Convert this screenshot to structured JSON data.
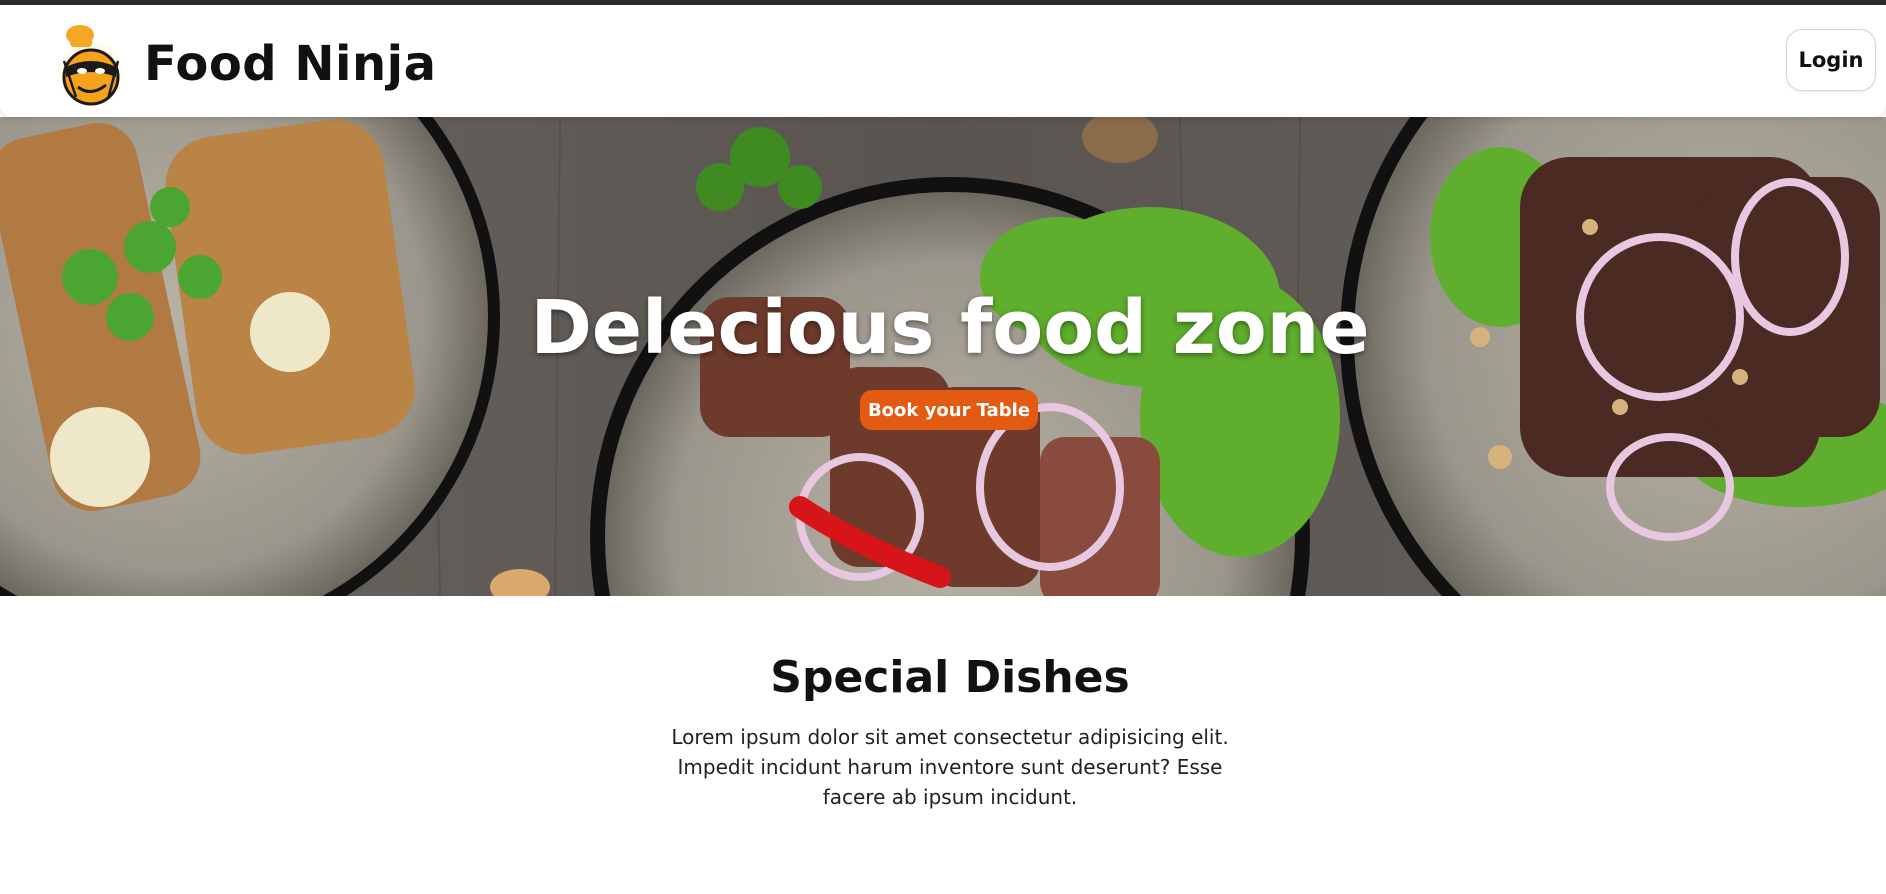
{
  "navbar": {
    "brand_name": "Food Ninja",
    "logo_icon": "ninja-chef-logo",
    "login_label": "Login"
  },
  "hero": {
    "title": "Delecious food zone",
    "cta_label": "Book your Table"
  },
  "special": {
    "title": "Special Dishes",
    "description": "Lorem ipsum dolor sit amet consectetur adipisicing elit. Impedit incidunt harum inventore sunt deserunt? Esse facere ab ipsum incidunt."
  },
  "colors": {
    "accent": "#e35a12",
    "top_bar": "#2b2b2b",
    "text": "#111111"
  }
}
